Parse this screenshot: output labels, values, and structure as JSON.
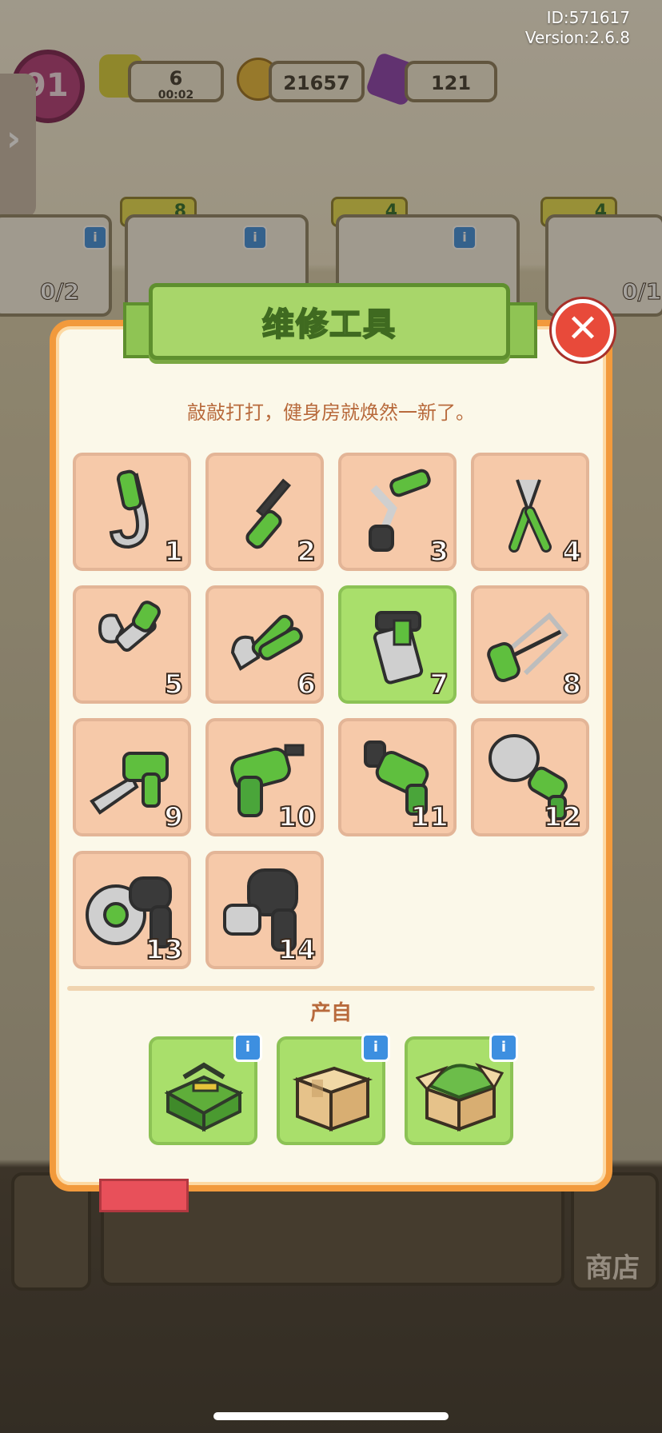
{
  "header": {
    "id_text": "ID:571617",
    "version_text": "Version:2.6.8"
  },
  "hud": {
    "level": "91",
    "energy": {
      "value": "6",
      "timer": "00:02"
    },
    "coins": "21657",
    "gems": "121"
  },
  "background_cards": [
    {
      "tag": "",
      "count": "0/2"
    },
    {
      "tag": "8",
      "count": ""
    },
    {
      "tag": "4",
      "count": ""
    },
    {
      "tag": "4",
      "count": "0/1"
    }
  ],
  "shop_label": "商店",
  "modal": {
    "title": "维修工具",
    "description": "敲敲打打，健身房就焕然一新了。",
    "close_icon": "✕",
    "tools": [
      {
        "num": "1",
        "icon": "hook-tool-icon"
      },
      {
        "num": "2",
        "icon": "screwdriver-icon"
      },
      {
        "num": "3",
        "icon": "socket-wrench-icon"
      },
      {
        "num": "4",
        "icon": "pliers-icon"
      },
      {
        "num": "5",
        "icon": "adjustable-wrench-icon"
      },
      {
        "num": "6",
        "icon": "pipe-wrench-icon"
      },
      {
        "num": "7",
        "icon": "large-wrench-icon",
        "selected": true
      },
      {
        "num": "8",
        "icon": "hacksaw-icon"
      },
      {
        "num": "9",
        "icon": "electric-saw-icon"
      },
      {
        "num": "10",
        "icon": "cordless-drill-icon"
      },
      {
        "num": "11",
        "icon": "hammer-drill-icon"
      },
      {
        "num": "12",
        "icon": "hole-saw-drill-icon"
      },
      {
        "num": "13",
        "icon": "angle-grinder-icon"
      },
      {
        "num": "14",
        "icon": "impact-driver-icon"
      }
    ],
    "source_label": "产自",
    "sources": [
      {
        "icon": "green-toolbox-icon",
        "info": "i"
      },
      {
        "icon": "cardboard-box-icon",
        "info": "i"
      },
      {
        "icon": "open-box-icon",
        "info": "i"
      }
    ]
  },
  "colors": {
    "modal_border": "#f29a3c",
    "tile": "#f6c9a9",
    "selected_tile": "#a9df6b",
    "accent_green": "#a8d66a",
    "close_red": "#e84a3a"
  }
}
